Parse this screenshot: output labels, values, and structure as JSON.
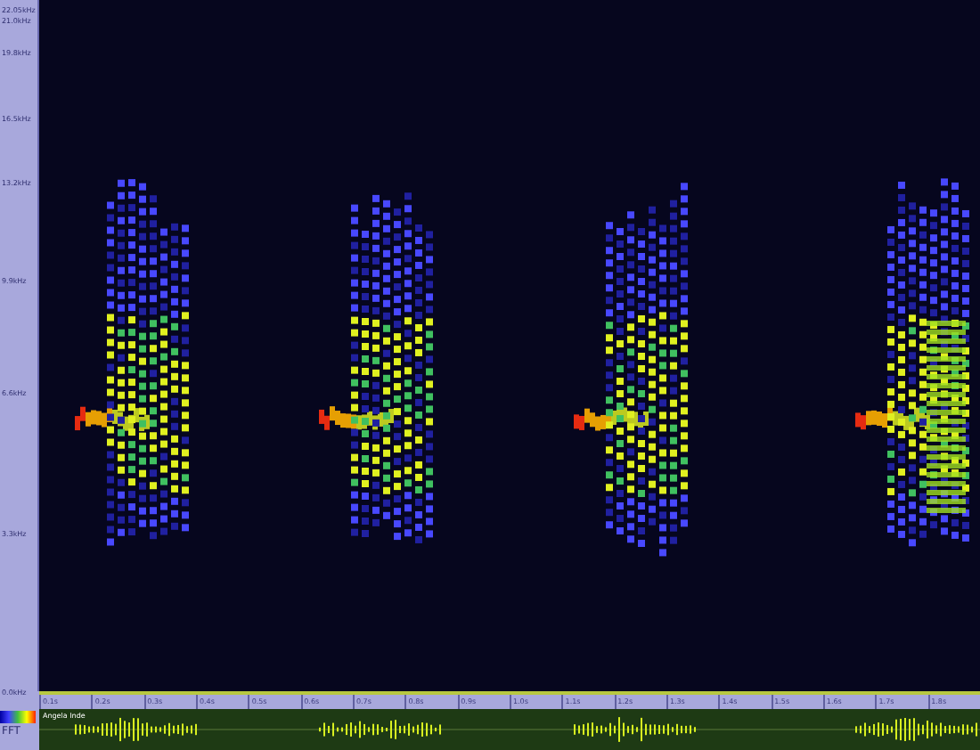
{
  "frequency_axis": {
    "labels": [
      "22.05kHz",
      "21.0kHz",
      "19.8kHz",
      "16.5kHz",
      "13.2kHz",
      "9.9kHz",
      "6.6kHz",
      "3.3kHz",
      "0.0kHz"
    ]
  },
  "time_axis": {
    "labels": [
      "0.1s",
      "0.2s",
      "0.3s",
      "0.4s",
      "0.5s",
      "0.6s",
      "0.7s",
      "0.8s",
      "0.9s",
      "1.0s",
      "1.1s",
      "1.2s",
      "1.3s",
      "1.4s",
      "1.5s",
      "1.6s",
      "1.7s",
      "1.8s"
    ]
  },
  "track": {
    "name": "Angela Inde"
  },
  "legend": {
    "label": "FFT"
  }
}
